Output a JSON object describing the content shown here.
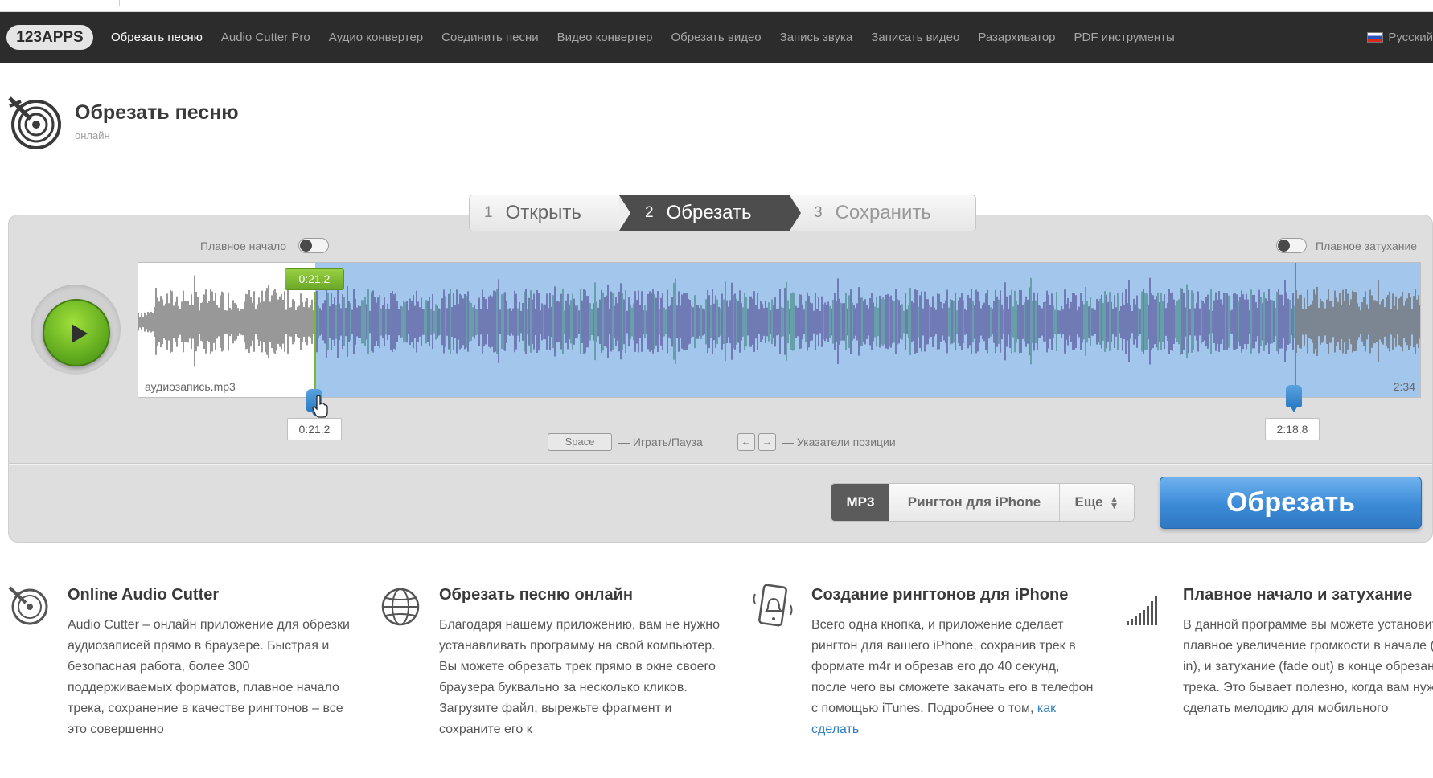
{
  "nav": {
    "logo": "123APPS",
    "items": [
      {
        "label": "Обрезать песню",
        "active": true
      },
      {
        "label": "Audio Cutter Pro",
        "active": false
      },
      {
        "label": "Аудио конвертер",
        "active": false
      },
      {
        "label": "Соединить песни",
        "active": false
      },
      {
        "label": "Видео конвертер",
        "active": false
      },
      {
        "label": "Обрезать видео",
        "active": false
      },
      {
        "label": "Запись звука",
        "active": false
      },
      {
        "label": "Записать видео",
        "active": false
      },
      {
        "label": "Разархиватор",
        "active": false
      },
      {
        "label": "PDF инструменты",
        "active": false
      }
    ],
    "language": "Русский"
  },
  "header": {
    "title": "Обрезать песню",
    "subtitle": "онлайн"
  },
  "steps": [
    {
      "num": "1",
      "label": "Открыть"
    },
    {
      "num": "2",
      "label": "Обрезать"
    },
    {
      "num": "3",
      "label": "Сохранить"
    }
  ],
  "editor": {
    "fade_in_label": "Плавное начало",
    "fade_out_label": "Плавное затухание",
    "fade_in_on": false,
    "fade_out_on": false,
    "file_name": "аудиозапись.mp3",
    "duration": "2:34",
    "current_time": "0:21.2",
    "start_time": "0:21.2",
    "end_time": "2:18.8",
    "selection_start_fraction": 0.138,
    "selection_end_fraction": 0.901
  },
  "hints": {
    "space_key": "Space",
    "play_pause": "— Играть/Пауза",
    "left_key": "←",
    "right_key": "→",
    "position_markers": "— Указатели позиции"
  },
  "formats": {
    "mp3": "MP3",
    "iphone": "Рингтон для iPhone",
    "more": "Еще"
  },
  "cut_button": "Обрезать",
  "features": [
    {
      "icon": "vinyl-cut-icon",
      "title": "Online Audio Cutter",
      "text": "Audio Cutter – онлайн приложение для обрезки аудиозаписей прямо в браузере. Быстрая и безопасная работа, более 300 поддерживаемых форматов, плавное начало трека, сохранение в качестве рингтонов – все это совершенно"
    },
    {
      "icon": "globe-icon",
      "title": "Обрезать песню онлайн",
      "text": "Благодаря нашему приложению, вам не нужно устанавливать программу на свой компьютер. Вы можете обрезать трек прямо в окне своего браузера буквально за несколько кликов. Загрузите файл, вырежьте фрагмент и сохраните его к"
    },
    {
      "icon": "phone-bell-icon",
      "title": "Создание рингтонов для iPhone",
      "text": "Всего одна кнопка, и приложение сделает рингтон для вашего iPhone, сохранив трек в формате m4r и обрезав его до 40 секунд, после чего вы сможете закачать его в телефон с помощью iTunes. Подробнее о том,",
      "link": "как сделать"
    },
    {
      "icon": "volume-bars-icon",
      "title": "Плавное начало и затухание",
      "text": "В данной программе вы можете установить плавное увеличение громкости в начале (fade in), и затухание (fade out) в конце обрезанного трека. Это бывает полезно, когда вам нужно сделать мелодию для мобильного"
    }
  ],
  "colors": {
    "nav_bg": "#2c2c2c",
    "selection": "#a3c6ec",
    "waveform": "#5a5a9e",
    "cut_button": "#3b8ad6",
    "play_button": "#6bb320"
  }
}
